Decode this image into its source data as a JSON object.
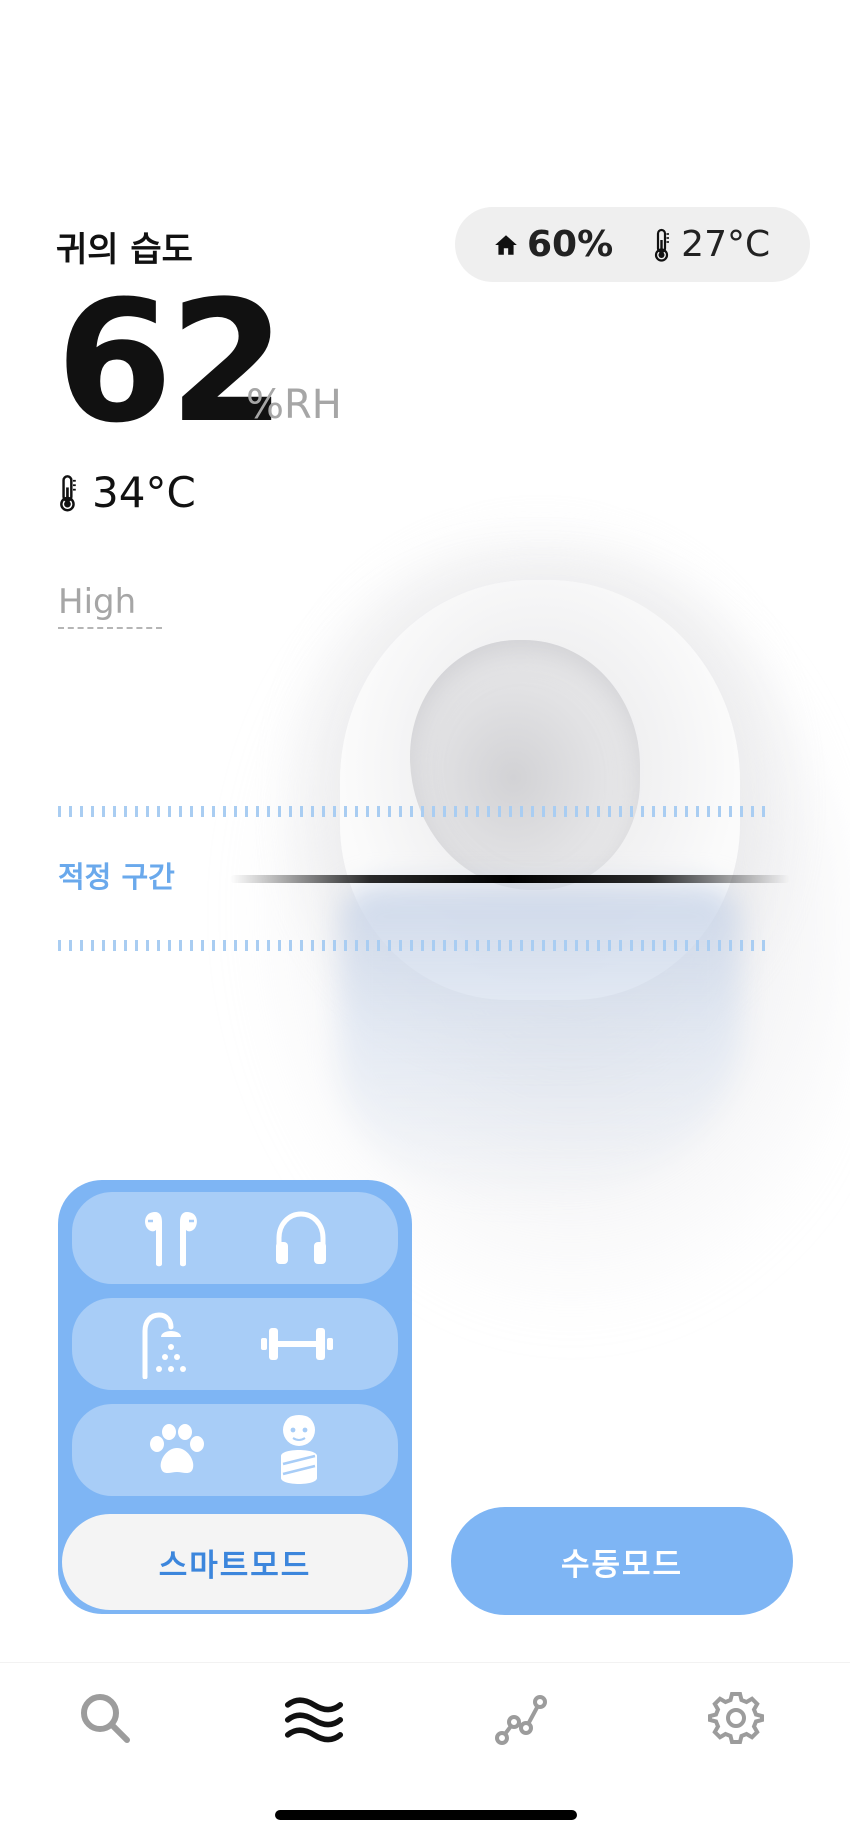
{
  "header": {
    "title": "귀의 습도",
    "env": {
      "humidity_icon": "home-icon",
      "humidity": "60%",
      "temp_icon": "thermometer-icon",
      "temperature": "27°C"
    }
  },
  "reading": {
    "humidity_value": "62",
    "humidity_unit": "%RH",
    "temp_icon": "thermometer-icon",
    "temperature": "34°C"
  },
  "scale": {
    "high_label": "High",
    "zone_label": "적정 구간"
  },
  "modes": {
    "rows": [
      [
        "earbuds-icon",
        "headphones-icon"
      ],
      [
        "shower-icon",
        "dumbbell-icon"
      ],
      [
        "paw-icon",
        "baby-icon"
      ]
    ],
    "smart_label": "스마트모드",
    "manual_label": "수동모드"
  },
  "tabbar": {
    "items": [
      "search-icon",
      "waves-icon",
      "chart-icon",
      "gear-icon"
    ],
    "active_index": 1
  },
  "colors": {
    "accent": "#7eb5f4",
    "accent_light": "#a8cdf7",
    "zone_text": "#6aa9ec",
    "smart_text": "#3c86dc"
  }
}
